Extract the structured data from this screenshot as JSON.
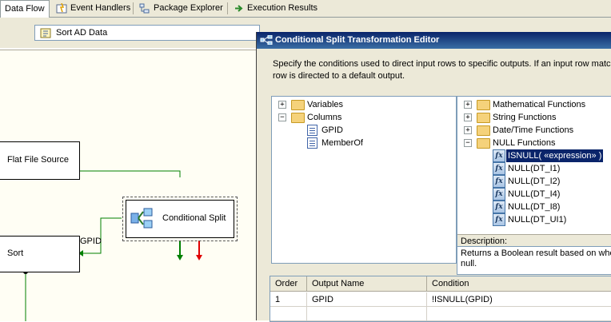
{
  "tabs": [
    {
      "label": "Data Flow",
      "icon": "data-flow-icon"
    },
    {
      "label": "Event Handlers",
      "icon": "event-handlers-icon"
    },
    {
      "label": "Package Explorer",
      "icon": "package-explorer-icon"
    },
    {
      "label": "Execution Results",
      "icon": "execution-results-icon"
    }
  ],
  "designer": {
    "data_flow_task": "Sort AD Data",
    "components": {
      "flat_file_source": "Flat File Source",
      "conditional_split": "Conditional Split",
      "sort": "Sort"
    },
    "path_label": "GPID"
  },
  "editor": {
    "title": "Conditional Split Transformation Editor",
    "description_line1": "Specify the conditions used to direct input rows to specific outputs. If an input row match",
    "description_line2": "row is directed to a default output.",
    "left_tree": {
      "variables": "Variables",
      "columns": "Columns",
      "column_items": [
        "GPID",
        "MemberOf"
      ]
    },
    "right_tree": {
      "groups": [
        "Mathematical Functions",
        "String Functions",
        "Date/Time Functions",
        "NULL Functions"
      ],
      "null_functions": [
        "ISNULL( «expression» )",
        "NULL(DT_I1)",
        "NULL(DT_I2)",
        "NULL(DT_I4)",
        "NULL(DT_I8)",
        "NULL(DT_UI1)"
      ],
      "selected_index": 0
    },
    "description_panel": {
      "header": "Description:",
      "text_line1": "Returns a Boolean result based on whet",
      "text_line2": "null."
    },
    "grid": {
      "headers": [
        "Order",
        "Output Name",
        "Condition"
      ],
      "rows": [
        {
          "order": "1",
          "output_name": "GPID",
          "condition": "!ISNULL(GPID)"
        }
      ]
    }
  },
  "colors": {
    "title_bar": "#0a246a",
    "dialog_bg": "#ece9d8",
    "canvas_bg": "#fffef4",
    "connector_green": "#008000",
    "error_red": "#e00000"
  }
}
